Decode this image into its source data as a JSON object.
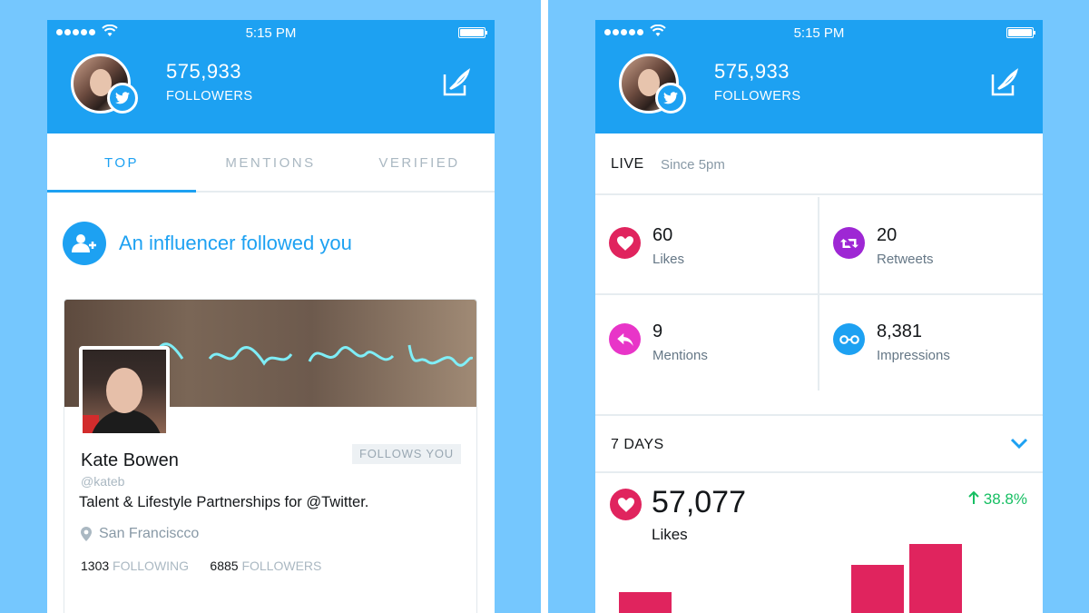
{
  "status_bar": {
    "time": "5:15 PM"
  },
  "account": {
    "followers_count": "575,933",
    "followers_label": "FOLLOWERS"
  },
  "left_screen": {
    "tabs": [
      {
        "label": "TOP",
        "active": true
      },
      {
        "label": "MENTIONS",
        "active": false
      },
      {
        "label": "VERIFIED",
        "active": false
      }
    ],
    "notification": {
      "text": "An influencer followed you"
    },
    "profile_card": {
      "name": "Kate Bowen",
      "handle": "@kateb",
      "follows_you": "FOLLOWS YOU",
      "bio": "Talent & Lifestyle Partnerships for @Twitter.",
      "location": "San Franciscco",
      "following_count": "1303",
      "following_label": "FOLLOWING",
      "followers_count": "6885",
      "followers_label": "FOLLOWERS"
    }
  },
  "right_screen": {
    "live": {
      "label": "LIVE",
      "since": "Since 5pm"
    },
    "stats": [
      {
        "value": "60",
        "label": "Likes",
        "icon": "heart-icon",
        "color": "#e0245e"
      },
      {
        "value": "20",
        "label": "Retweets",
        "icon": "retweet-icon",
        "color": "#9e27d4"
      },
      {
        "value": "9",
        "label": "Mentions",
        "icon": "reply-icon",
        "color": "#e835c8"
      },
      {
        "value": "8,381",
        "label": "Impressions",
        "icon": "glasses-icon",
        "color": "#1da1f2"
      }
    ],
    "period": {
      "label": "7 DAYS"
    },
    "summary": {
      "value": "57,077",
      "label": "Likes",
      "change": "38.8%"
    },
    "chart_data": {
      "type": "bar",
      "values": [
        18,
        0,
        0,
        0,
        41,
        59
      ],
      "colors": {
        "bar": "#e0245e"
      }
    }
  },
  "colors": {
    "brand": "#1da1f2",
    "background": "#75c7fe",
    "positive": "#17bf63"
  }
}
